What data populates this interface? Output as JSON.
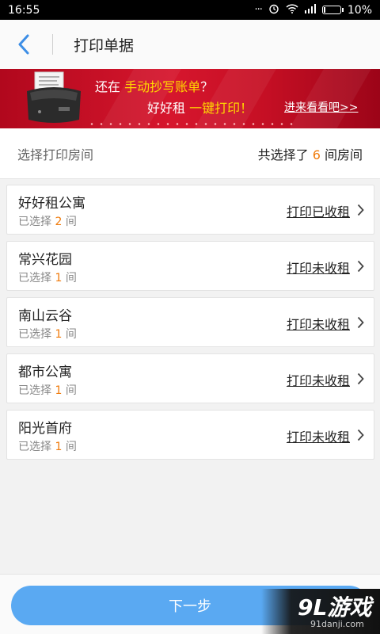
{
  "status_bar": {
    "time": "16:55",
    "battery": "10%",
    "battery_level": 0.1,
    "icons": [
      "signal-dots-icon",
      "alarm-icon",
      "wifi-icon",
      "cell-signal-icon",
      "battery-icon"
    ]
  },
  "header": {
    "title": "打印单据"
  },
  "banner": {
    "line1_prefix": "还在",
    "line1_highlight": "手动抄写账单",
    "line1_suffix": "？",
    "line2_prefix": "好好租",
    "line2_highlight": "一键打印！",
    "link": "进来看看吧>>"
  },
  "summary": {
    "label": "选择打印房间",
    "count_prefix": "共选择了",
    "count_value": "6",
    "count_suffix": "间房间"
  },
  "estates": [
    {
      "name": "好好租公寓",
      "selected_prefix": "已选择",
      "selected_count": "2",
      "selected_suffix": "间",
      "action": "打印已收租"
    },
    {
      "name": "常兴花园",
      "selected_prefix": "已选择",
      "selected_count": "1",
      "selected_suffix": "间",
      "action": "打印未收租"
    },
    {
      "name": "南山云谷",
      "selected_prefix": "已选择",
      "selected_count": "1",
      "selected_suffix": "间",
      "action": "打印未收租"
    },
    {
      "name": "都市公寓",
      "selected_prefix": "已选择",
      "selected_count": "1",
      "selected_suffix": "间",
      "action": "打印未收租"
    },
    {
      "name": "阳光首府",
      "selected_prefix": "已选择",
      "selected_count": "1",
      "selected_suffix": "间",
      "action": "打印未收租"
    }
  ],
  "footer": {
    "next_button": "下一步"
  },
  "watermark": {
    "brand": "9L游戏",
    "site": "91danji.com"
  },
  "colors": {
    "accent_blue": "#5aa9f2",
    "highlight_orange": "#f07b0c",
    "banner_red": "#d6162d",
    "banner_yellow": "#ffd800"
  }
}
